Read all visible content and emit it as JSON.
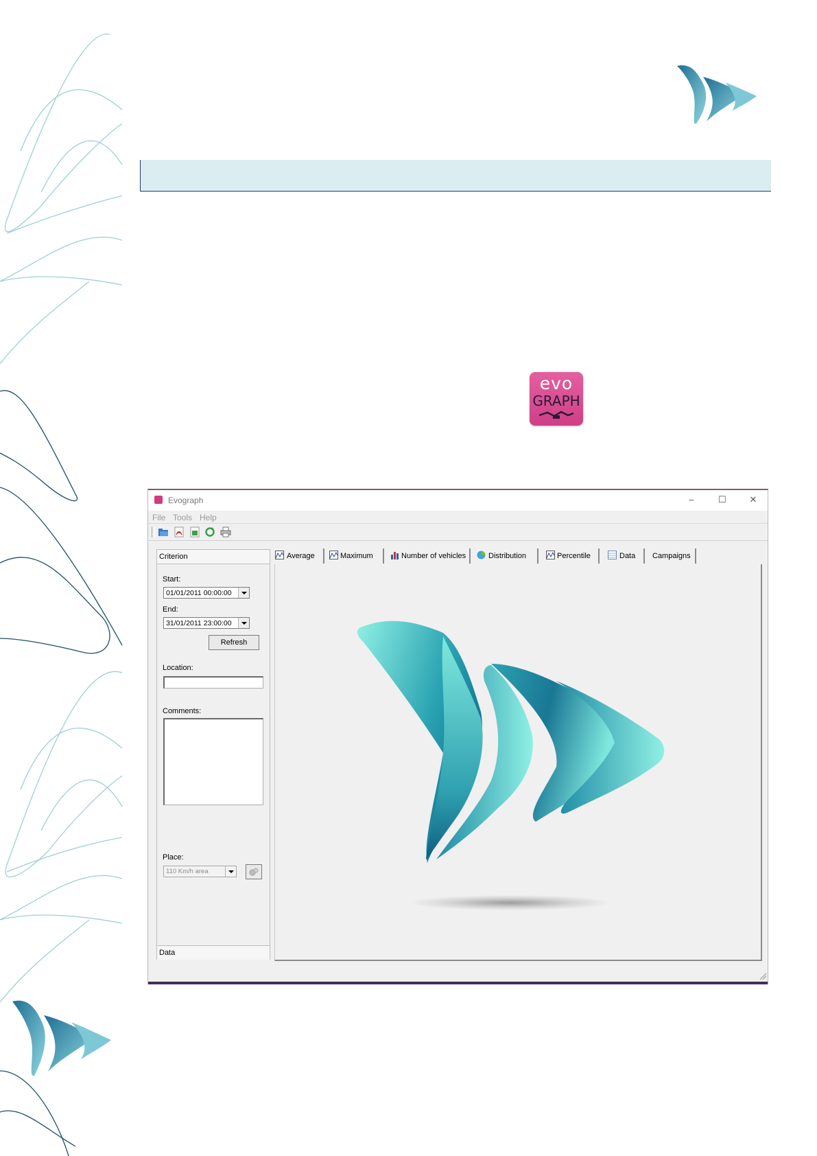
{
  "colors": {
    "header_band": "#dcedf2",
    "evograph_icon": "#d9488f",
    "logo_dark": "#1f6f94",
    "logo_light": "#6fd3d6"
  },
  "evograph_icon": {
    "line1": "evo",
    "line2": "GRAPH"
  },
  "window": {
    "title": "Evograph",
    "controls": {
      "minimize": "–",
      "maximize": "☐",
      "close": "✕"
    },
    "menu": [
      "File",
      "Tools",
      "Help"
    ],
    "toolbar_icons": [
      "open-folder-icon",
      "pdf-icon",
      "export-image-icon",
      "refresh-icon",
      "print-icon"
    ],
    "criterion_panel": {
      "title": "Criterion",
      "start_label": "Start:",
      "start_value": "01/01/2011 00:00:00",
      "end_label": "End:",
      "end_value": "31/01/2011 23:00:00",
      "refresh_label": "Refresh",
      "location_label": "Location:",
      "location_value": "",
      "comments_label": "Comments:",
      "comments_value": "",
      "place_label": "Place:",
      "place_value": "110  Km/h area",
      "footer": "Data"
    },
    "tabs": [
      "Average",
      "Maximum",
      "Number of vehicles",
      "Distribution",
      "Percentile",
      "Data",
      "Campaigns"
    ]
  }
}
